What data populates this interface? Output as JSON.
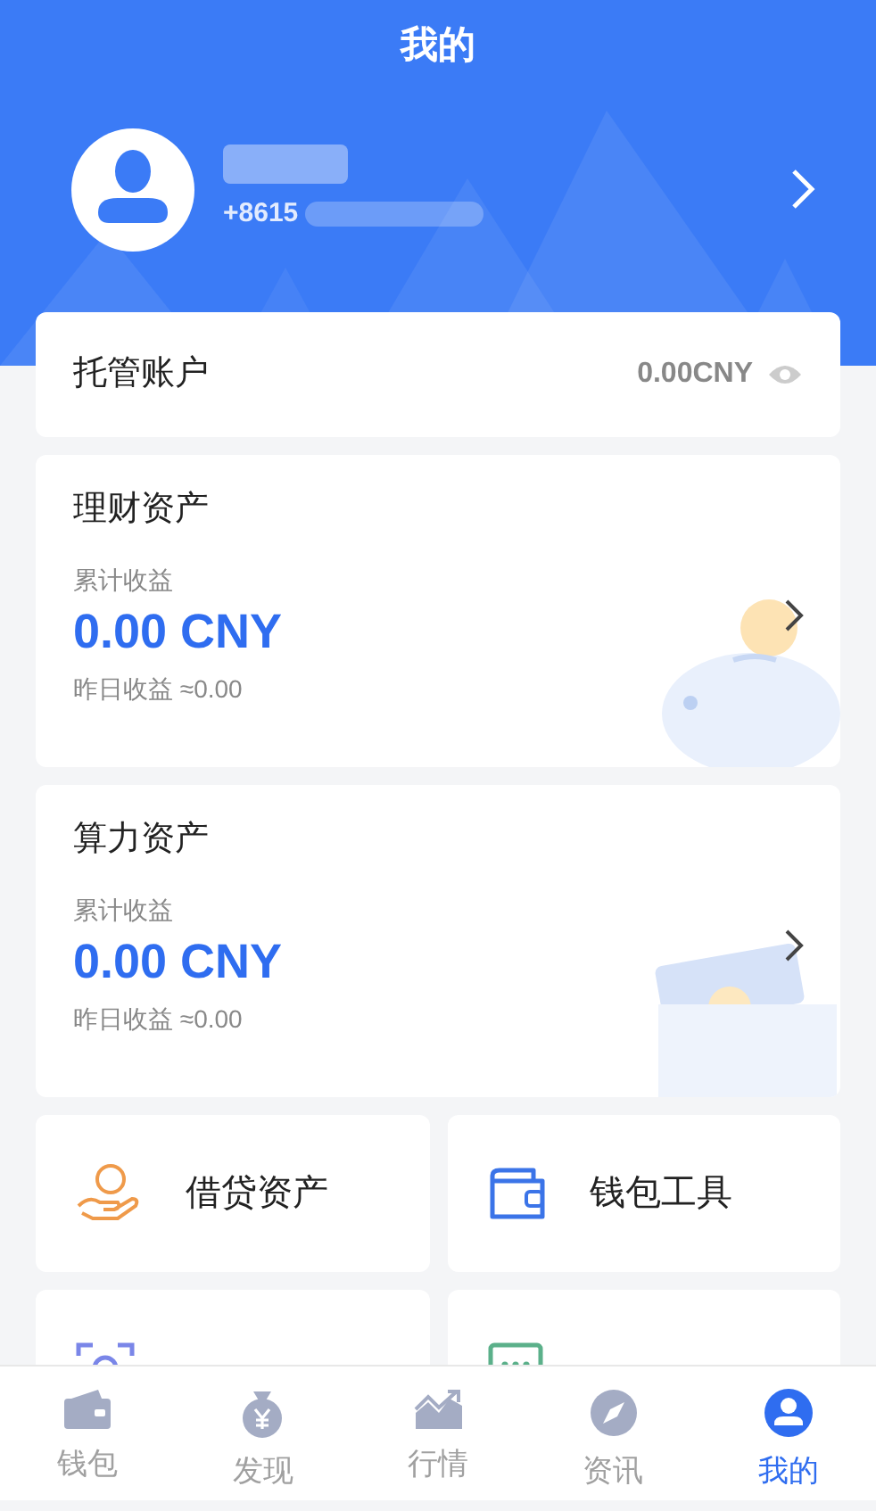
{
  "header": {
    "title": "我的"
  },
  "profile": {
    "phone": "+8615"
  },
  "custody": {
    "label": "托管账户",
    "amount": "0.00CNY"
  },
  "asset_cards": [
    {
      "kind": "piggy",
      "title": "理财资产",
      "total_label": "累计收益",
      "total": "0.00 CNY",
      "yesterday": "昨日收益 ≈0.00"
    },
    {
      "kind": "wallet",
      "title": "算力资产",
      "total_label": "累计收益",
      "total": "0.00 CNY",
      "yesterday": "昨日收益 ≈0.00"
    }
  ],
  "tiles": [
    {
      "kind": "loan",
      "label": "借贷资产"
    },
    {
      "kind": "wallet",
      "label": "钱包工具"
    },
    {
      "kind": "identity"
    },
    {
      "kind": "chat"
    }
  ],
  "tab_bar": [
    {
      "kind": "wallet",
      "label": "钱包",
      "selected": false
    },
    {
      "kind": "discover",
      "label": "发现",
      "selected": false
    },
    {
      "kind": "market",
      "label": "行情",
      "selected": false
    },
    {
      "kind": "news",
      "label": "资讯",
      "selected": false
    },
    {
      "kind": "me",
      "label": "我的",
      "selected": true
    }
  ]
}
